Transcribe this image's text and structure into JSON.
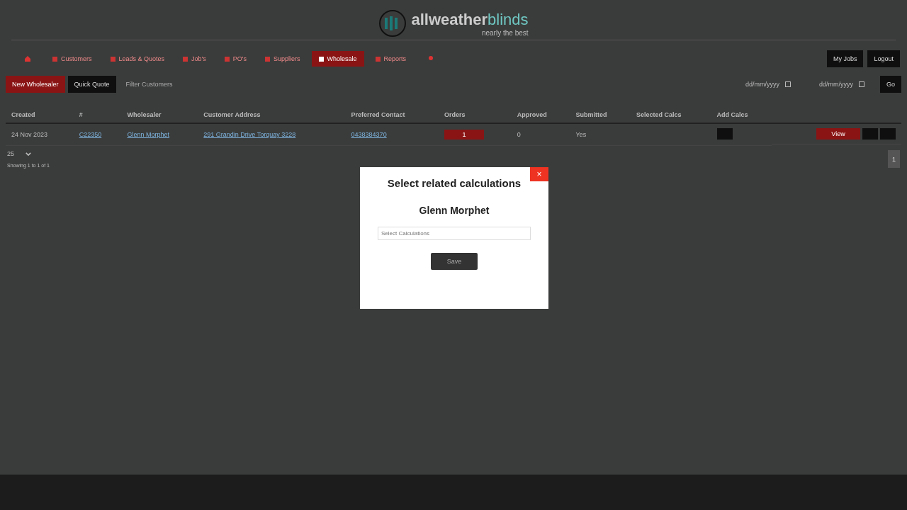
{
  "logo": {
    "name_a": "allweather",
    "name_b": "blinds",
    "tagline": "nearly the best"
  },
  "nav": {
    "items": [
      {
        "label": "Customers",
        "selected": false
      },
      {
        "label": "Leads & Quotes",
        "selected": false
      },
      {
        "label": "Job's",
        "selected": false
      },
      {
        "label": "PO's",
        "selected": false
      },
      {
        "label": "Suppliers",
        "selected": false
      },
      {
        "label": "Wholesale",
        "selected": true
      },
      {
        "label": "Reports",
        "selected": false
      }
    ],
    "right_buttons": [
      "My Jobs",
      "Logout"
    ]
  },
  "toolbar": {
    "new_button": "New Wholesaler",
    "quick_button": "Quick Quote",
    "filter_placeholder": "Filter Customers",
    "date_from": "dd/mm/yyyy",
    "date_to": "dd/mm/yyyy",
    "go": "Go"
  },
  "table": {
    "columns": [
      "Created",
      "#",
      "Wholesaler",
      "Customer Address",
      "Preferred Contact",
      "Orders",
      "Approved",
      "Submitted",
      "Selected Calcs",
      "Add Calcs"
    ],
    "rows": [
      {
        "created": "24 Nov 2023",
        "number": "C22350",
        "wholesaler": "Glenn Morphet",
        "address": "291 Grandin Drive Torquay 3228",
        "contact": "0438384370",
        "orders": "1",
        "approved": "0",
        "submitted": "Yes",
        "view": "View"
      }
    ]
  },
  "page_size": "25",
  "showing": "Showing 1 to 1 of 1",
  "page": "1",
  "modal": {
    "title": "Select related calculations",
    "name": "Glenn Morphet",
    "placeholder": "Select Calculations",
    "save": "Save",
    "close": "×"
  }
}
